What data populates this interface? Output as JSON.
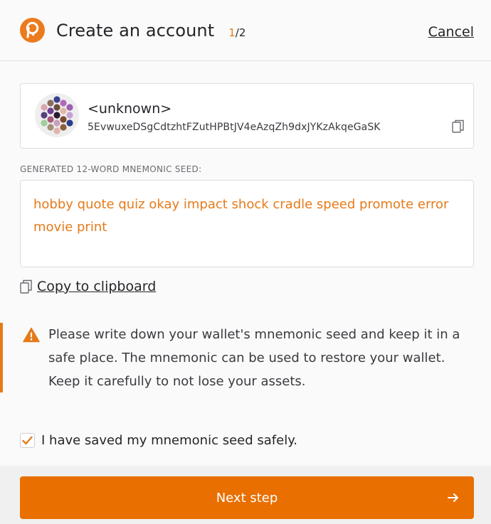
{
  "header": {
    "title": "Create an account",
    "step_current": "1",
    "step_total": "/2",
    "cancel_label": "Cancel"
  },
  "account": {
    "name": "<unknown>",
    "address": "5EvwuxeDSgCdtzhtFZutHPBtJV4eAzqZh9dxJYKzAkqeGaSK"
  },
  "seed": {
    "label": "GENERATED 12-WORD MNEMONIC SEED:",
    "phrase": "hobby quote quiz okay impact shock cradle speed promote error movie print"
  },
  "clipboard": {
    "label": "Copy to clipboard"
  },
  "warning": {
    "text": "Please write down your wallet's mnemonic seed and keep it in a safe place. The mnemonic can be used to restore your wallet. Keep it carefully to not lose your assets."
  },
  "confirm": {
    "label": "I have saved my mnemonic seed safely.",
    "checked": true
  },
  "next_button": {
    "label": "Next step"
  },
  "icons": {
    "logo": "polkadot-logo-icon",
    "copy": "copy-icon",
    "warning": "warning-triangle-icon",
    "check": "check-icon",
    "arrow": "arrow-right-icon"
  },
  "colors": {
    "accent": "#e86f00",
    "seed_text": "#e57a1a"
  }
}
